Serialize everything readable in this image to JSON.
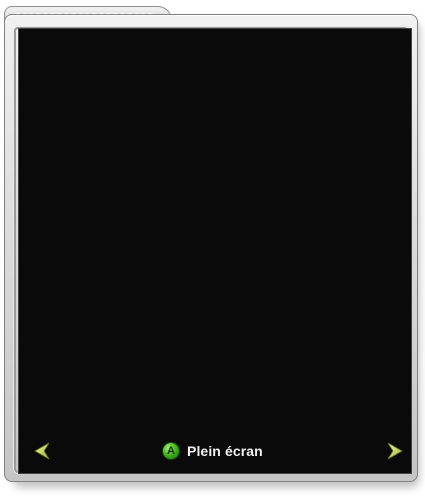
{
  "navigation": {
    "previous_icon": "arrow-left-icon",
    "next_icon": "arrow-right-icon",
    "arrow_color": "#d6e86a"
  },
  "action_hint": {
    "button_glyph": "A",
    "button_color": "#43b71c",
    "label": "Plein écran"
  }
}
